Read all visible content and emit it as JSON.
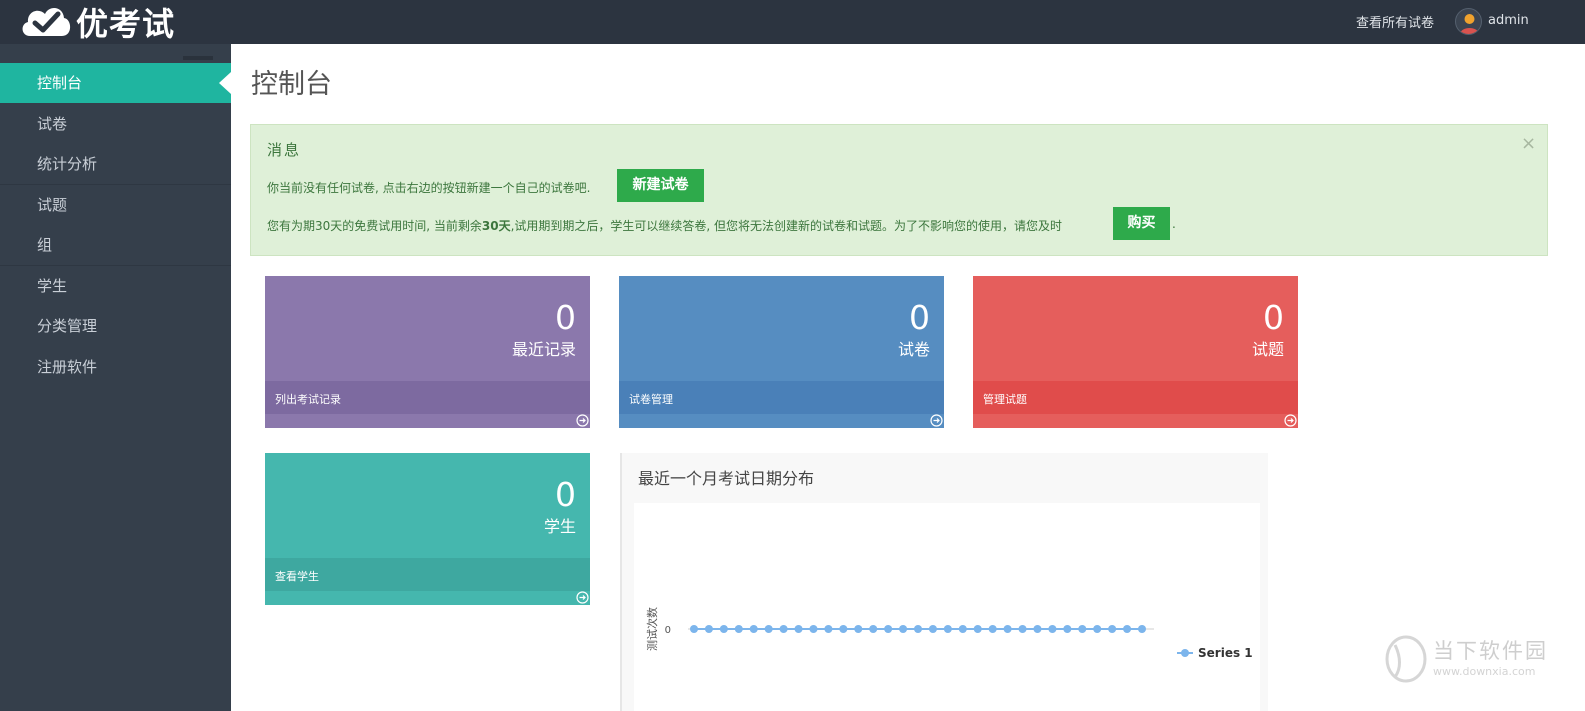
{
  "header": {
    "brand": "优考试",
    "view_all_link": "查看所有试卷",
    "username": "admin"
  },
  "sidebar": {
    "items": [
      {
        "label": "控制台",
        "active": true
      },
      {
        "label": "试卷"
      },
      {
        "label": "统计分析"
      },
      {
        "label": "试题"
      },
      {
        "label": "组"
      },
      {
        "label": "学生"
      },
      {
        "label": "分类管理"
      },
      {
        "label": "注册软件"
      }
    ]
  },
  "main": {
    "title": "控制台",
    "alert": {
      "title": "消息",
      "line1": "你当前没有任何试卷, 点击右边的按钮新建一个自己的试卷吧.",
      "new_button": "新建试卷",
      "line2_prefix": "您有为期30天的免费试用时间, 当前剩余",
      "line2_bold": "30天",
      "line2_suffix": ",试用期到期之后，学生可以继续答卷, 但您将无法创建新的试卷和试题。为了不影响您的使用，请您及时",
      "buy_button": "购买",
      "line2_end": ".",
      "close": "×"
    },
    "cards": [
      {
        "count": "0",
        "label": "最近记录",
        "footer": "列出考试记录",
        "color": "#8b78ac"
      },
      {
        "count": "0",
        "label": "试卷",
        "footer": "试卷管理",
        "color": "#568dc1"
      },
      {
        "count": "0",
        "label": "试题",
        "footer": "管理试题",
        "color": "#e55e5c"
      },
      {
        "count": "0",
        "label": "学生",
        "footer": "查看学生",
        "color": "#45b7ae"
      }
    ],
    "chart_panel_title": "最近一个月考试日期分布"
  },
  "chart_data": {
    "type": "line",
    "title": "",
    "xlabel": "",
    "ylabel": "测试次数",
    "y_tick_labels": [
      "0"
    ],
    "series": [
      {
        "name": "Series 1",
        "color": "#7cb5ec",
        "values": [
          0,
          0,
          0,
          0,
          0,
          0,
          0,
          0,
          0,
          0,
          0,
          0,
          0,
          0,
          0,
          0,
          0,
          0,
          0,
          0,
          0,
          0,
          0,
          0,
          0,
          0,
          0,
          0,
          0,
          0,
          0
        ]
      }
    ],
    "legend_position": "bottom-right",
    "grid": false
  },
  "watermark": {
    "text": "当下软件园",
    "url": "www.downxia.com"
  }
}
